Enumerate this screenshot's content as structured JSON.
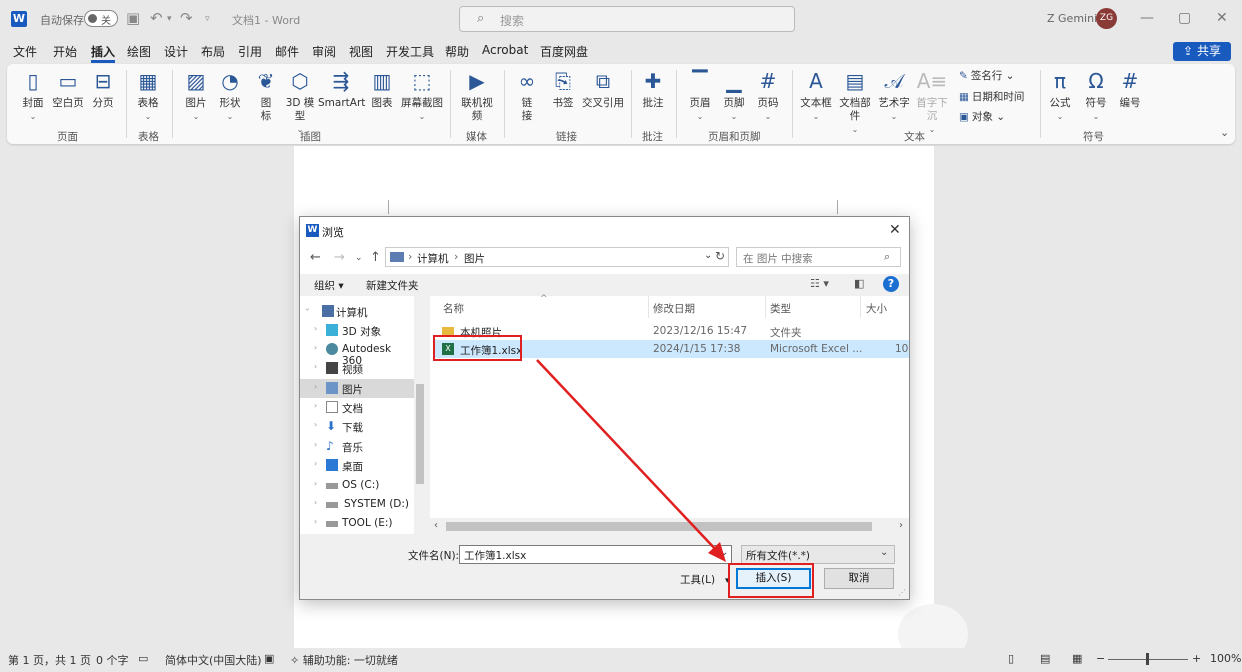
{
  "titlebar": {
    "logo_letter": "W",
    "autosave_label": "自动保存",
    "autosave_state": "关",
    "doc_title": "文档1 - Word",
    "search_placeholder": "搜索",
    "user_name": "Z Gemini",
    "user_initials": "ZG",
    "min_icon": "—",
    "max_icon": "▢",
    "close_icon": "✕"
  },
  "menu": {
    "tabs": [
      "文件",
      "开始",
      "插入",
      "绘图",
      "设计",
      "布局",
      "引用",
      "邮件",
      "审阅",
      "视图",
      "开发工具",
      "帮助",
      "Acrobat",
      "百度网盘"
    ],
    "active_tab": "插入",
    "share_label": "共享"
  },
  "ribbon": {
    "buttons": {
      "cover": "封面",
      "blank_page": "空白页",
      "page_break": "分页",
      "table": "表格",
      "picture": "图片",
      "shapes": "形状",
      "icons": "图标",
      "model3d": "3D 模型",
      "smartart": "SmartArt",
      "chart": "图表",
      "screenshot": "屏幕截图",
      "online_video": "联机视频",
      "link": "链接",
      "bookmark": "书签",
      "cross_ref": "交叉引用",
      "comment": "批注",
      "header": "页眉",
      "footer": "页脚",
      "page_number": "页码",
      "textbox": "文本框",
      "doc_parts": "文档部件",
      "wordart": "艺术字",
      "dropcap": "首字下沉",
      "signature": "签名行",
      "datetime": "日期和时间",
      "object": "对象",
      "equation": "公式",
      "symbol": "符号",
      "number": "编号"
    },
    "groups": {
      "pages": "页面",
      "tables": "表格",
      "illustrations": "插图",
      "media": "媒体",
      "links": "链接",
      "comments": "批注",
      "header_footer": "页眉和页脚",
      "text": "文本",
      "symbols": "符号"
    }
  },
  "dialog": {
    "title": "浏览",
    "path": [
      "计算机",
      "图片"
    ],
    "search_placeholder": "在 图片 中搜索",
    "toolbar": {
      "organize": "组织",
      "new_folder": "新建文件夹"
    },
    "tree": [
      {
        "label": "计算机",
        "icon": "computer-icon"
      },
      {
        "label": "3D 对象",
        "icon": "cube-icon"
      },
      {
        "label": "Autodesk 360",
        "icon": "cloud-icon"
      },
      {
        "label": "视频",
        "icon": "video-icon"
      },
      {
        "label": "图片",
        "icon": "pictures-icon"
      },
      {
        "label": "文档",
        "icon": "document-icon"
      },
      {
        "label": "下载",
        "icon": "download-icon"
      },
      {
        "label": "音乐",
        "icon": "music-icon"
      },
      {
        "label": "桌面",
        "icon": "desktop-icon"
      },
      {
        "label": "OS (C:)",
        "icon": "drive-icon"
      },
      {
        "label": "SYSTEM (D:)",
        "icon": "drive-icon"
      },
      {
        "label": "TOOL (E:)",
        "icon": "drive-icon"
      }
    ],
    "columns": [
      "名称",
      "修改日期",
      "类型",
      "大小"
    ],
    "files": [
      {
        "name": "本机照片",
        "date": "2023/12/16 15:47",
        "type": "文件夹",
        "size": "",
        "icon": "folder-icon"
      },
      {
        "name": "工作簿1.xlsx",
        "date": "2024/1/15 17:38",
        "type": "Microsoft Excel ...",
        "size": "10",
        "icon": "excel-file-icon"
      }
    ],
    "filename_label": "文件名(N):",
    "filename_value": "工作簿1.xlsx",
    "filetype_value": "所有文件(*.*)",
    "tools_label": "工具(L)",
    "insert_label": "插入(S)",
    "cancel_label": "取消"
  },
  "statusbar": {
    "page": "第 1 页，共 1 页",
    "words": "0 个字",
    "language": "简体中文(中国大陆)",
    "accessibility": "辅助功能: 一切就绪",
    "zoom": "100%"
  }
}
